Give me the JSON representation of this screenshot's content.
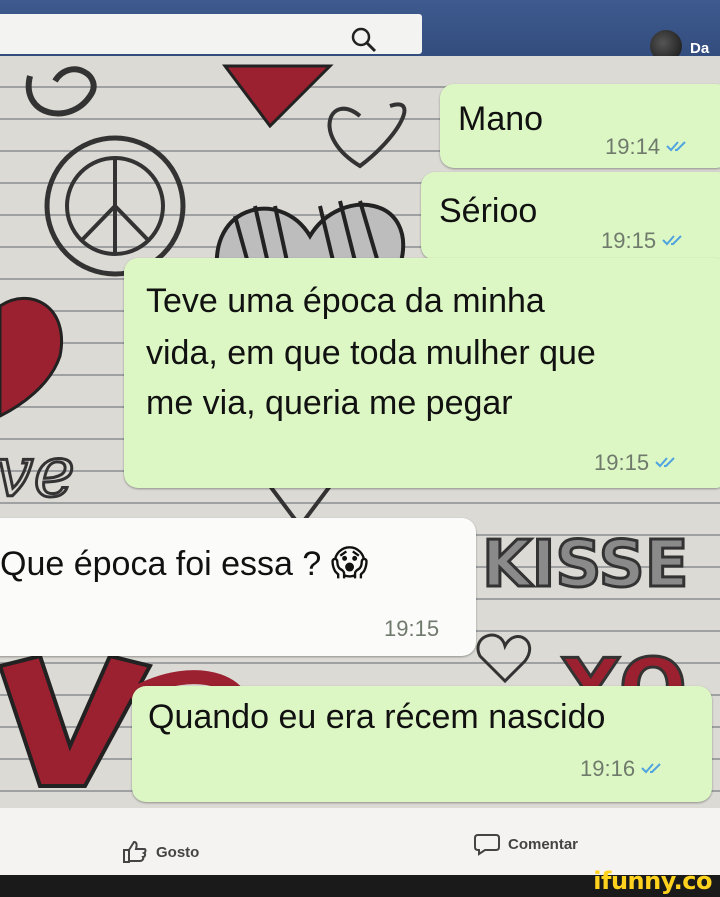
{
  "header": {
    "profile_name": "Da"
  },
  "messages": [
    {
      "text": "Mano",
      "time": "19:14",
      "direction": "outgoing",
      "status": "read"
    },
    {
      "text": "Sérioo",
      "time": "19:15",
      "direction": "outgoing",
      "status": "read"
    },
    {
      "lines": [
        "Teve uma época da minha",
        "vida, em que toda mulher que",
        "me via, queria me pegar"
      ],
      "time": "19:15",
      "direction": "outgoing",
      "status": "read"
    },
    {
      "text": "Que época foi essa ? ",
      "emoji": "😱",
      "time": "19:15",
      "direction": "incoming"
    },
    {
      "text": "Quando eu era récem nascido",
      "time": "19:16",
      "direction": "outgoing",
      "status": "read"
    }
  ],
  "wallpaper_words": {
    "kisse": "KISSE",
    "xo": "XO"
  },
  "actions": {
    "like_label": "Gosto",
    "comment_label": "Comentar"
  },
  "watermark": "ifunny.co",
  "colors": {
    "header": "#3b5998",
    "outgoing_bubble": "#dcf7c4",
    "incoming_bubble": "#ffffff",
    "read_ticks": "#4fa3e0",
    "watermark": "#ffd21e"
  },
  "icons": {
    "search": "search-icon",
    "like": "thumbs-up-icon",
    "comment": "speech-bubble-icon",
    "read": "double-check-icon"
  }
}
